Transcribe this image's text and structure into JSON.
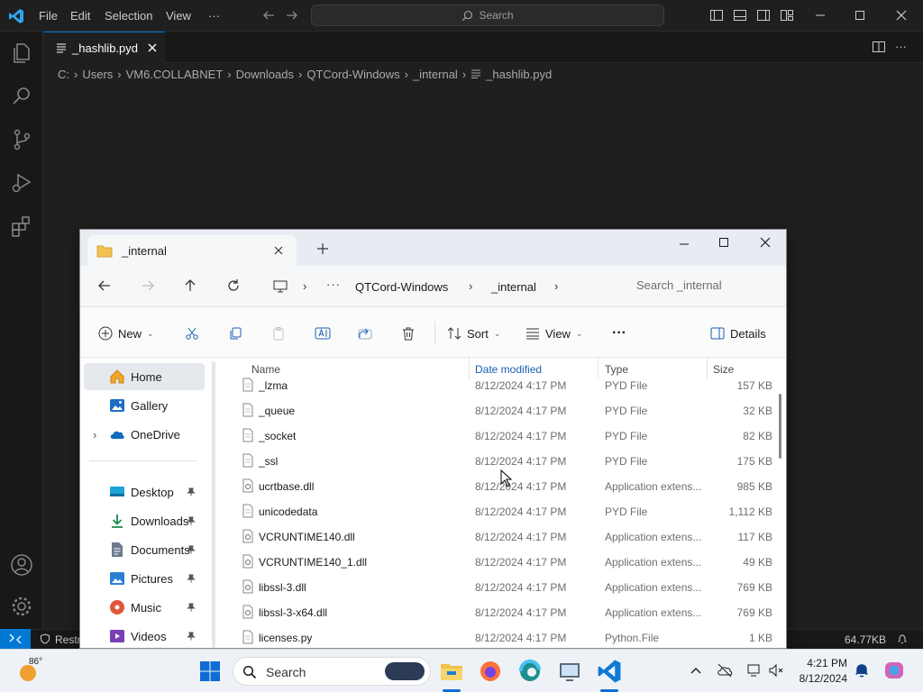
{
  "vscode": {
    "menu": [
      "File",
      "Edit",
      "Selection",
      "View",
      "···"
    ],
    "command_center": "Search",
    "tab_title": "_hashlib.pyd",
    "breadcrumb": [
      "C:",
      "Users",
      "VM6.COLLABNET",
      "Downloads",
      "QTCord-Windows",
      "_internal",
      "_hashlib.pyd"
    ],
    "status_left": "Restr",
    "status_right": "64.77KB"
  },
  "explorer": {
    "tab_title": "_internal",
    "path": [
      "QTCord-Windows",
      "_internal"
    ],
    "search_placeholder": "Search _internal",
    "toolbar": {
      "new": "New",
      "sort": "Sort",
      "view": "View",
      "details": "Details"
    },
    "sidebar": {
      "top": [
        {
          "label": "Home",
          "icon": "home-icon"
        },
        {
          "label": "Gallery",
          "icon": "gallery-icon"
        },
        {
          "label": "OneDrive",
          "icon": "onedrive-icon"
        }
      ],
      "quick": [
        {
          "label": "Desktop",
          "icon": "desktop-icon"
        },
        {
          "label": "Downloads",
          "icon": "downloads-icon"
        },
        {
          "label": "Documents",
          "icon": "documents-icon"
        },
        {
          "label": "Pictures",
          "icon": "pictures-icon"
        },
        {
          "label": "Music",
          "icon": "music-icon"
        },
        {
          "label": "Videos",
          "icon": "videos-icon"
        }
      ]
    },
    "columns": [
      "Name",
      "Date modified",
      "Type",
      "Size"
    ],
    "files": [
      {
        "name": "_lzma",
        "date": "8/12/2024 4:17 PM",
        "type": "PYD File",
        "size": "157 KB",
        "icon": "file-icon"
      },
      {
        "name": "_queue",
        "date": "8/12/2024 4:17 PM",
        "type": "PYD File",
        "size": "32 KB",
        "icon": "file-icon"
      },
      {
        "name": "_socket",
        "date": "8/12/2024 4:17 PM",
        "type": "PYD File",
        "size": "82 KB",
        "icon": "file-icon"
      },
      {
        "name": "_ssl",
        "date": "8/12/2024 4:17 PM",
        "type": "PYD File",
        "size": "175 KB",
        "icon": "file-icon"
      },
      {
        "name": "ucrtbase.dll",
        "date": "8/12/2024 4:17 PM",
        "type": "Application extens...",
        "size": "985 KB",
        "icon": "dll-icon"
      },
      {
        "name": "unicodedata",
        "date": "8/12/2024 4:17 PM",
        "type": "PYD File",
        "size": "1,112 KB",
        "icon": "file-icon"
      },
      {
        "name": "VCRUNTIME140.dll",
        "date": "8/12/2024 4:17 PM",
        "type": "Application extens...",
        "size": "117 KB",
        "icon": "dll-icon"
      },
      {
        "name": "VCRUNTIME140_1.dll",
        "date": "8/12/2024 4:17 PM",
        "type": "Application extens...",
        "size": "49 KB",
        "icon": "dll-icon"
      },
      {
        "name": "libssl-3.dll",
        "date": "8/12/2024 4:17 PM",
        "type": "Application extens...",
        "size": "769 KB",
        "icon": "dll-icon"
      },
      {
        "name": "libssl-3-x64.dll",
        "date": "8/12/2024 4:17 PM",
        "type": "Application extens...",
        "size": "769 KB",
        "icon": "dll-icon"
      },
      {
        "name": "licenses.py",
        "date": "8/12/2024 4:17 PM",
        "type": "Python.File",
        "size": "1 KB",
        "icon": "file-icon"
      }
    ]
  },
  "taskbar": {
    "weather": "86°",
    "search": "Search",
    "time": "4:21 PM",
    "date": "8/12/2024"
  },
  "colors": {
    "accent": "#0078d4",
    "vscode_bg": "#1f1f1f",
    "explorer_selected": "#e5e8ed"
  }
}
